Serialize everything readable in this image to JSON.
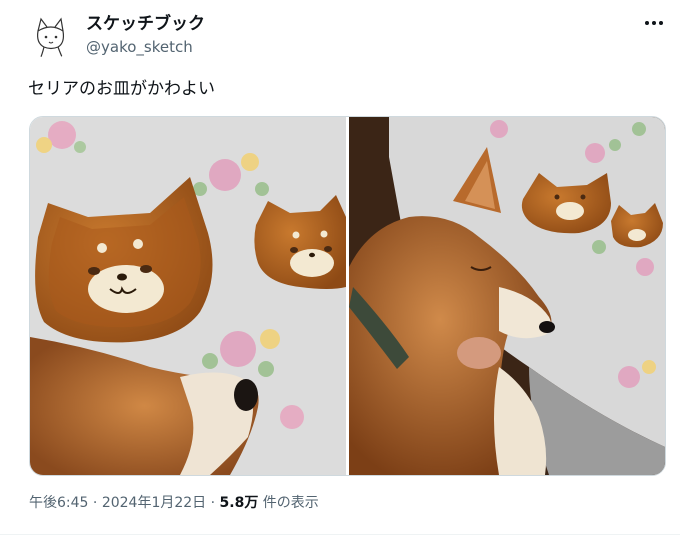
{
  "author": {
    "display_name": "スケッチブック",
    "handle": "@yako_sketch"
  },
  "tweet": {
    "text": "セリアのお皿がかわよい"
  },
  "media": {
    "photos": [
      "shiba-with-cat-plates-closeup",
      "shiba-at-table-with-plates"
    ]
  },
  "meta": {
    "time": "午後6:45",
    "sep1": " · ",
    "date": "2024年1月22日",
    "sep2": " · ",
    "views_count": "5.8万",
    "views_label": " 件の表示"
  },
  "colors": {
    "text": "#0f1419",
    "secondary": "#536471",
    "border": "#cfd9de",
    "plate": "#b5651d",
    "fur": "#c8783a"
  }
}
